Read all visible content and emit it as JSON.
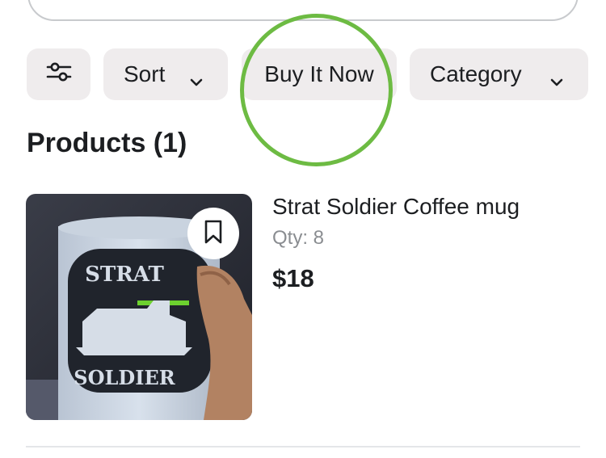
{
  "search": {
    "value": ""
  },
  "filters": {
    "filter_icon": "sliders-icon",
    "sort_label": "Sort",
    "buy_it_now_label": "Buy It Now",
    "category_label": "Category",
    "chevron_icon": "chevron-down-icon"
  },
  "highlight_color": "#6dbb43",
  "products": {
    "title": "Products (1)",
    "items": [
      {
        "name": "Strat Soldier Coffee mug",
        "qty": "Qty: 8",
        "price": "$18",
        "image_text_top": "STRAT",
        "image_text_bottom": "SOLDIER",
        "save_icon": "bookmark-icon"
      }
    ]
  }
}
